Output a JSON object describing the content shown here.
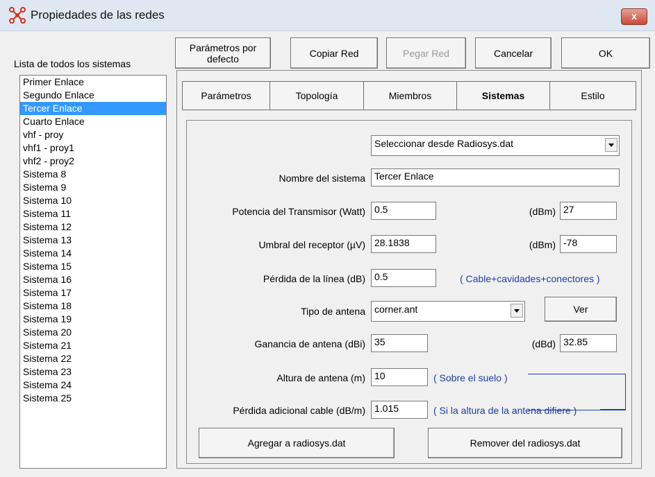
{
  "window": {
    "title": "Propiedades de las redes",
    "close_icon": "close-icon",
    "close_label": "x"
  },
  "toolbar": {
    "defaults_label": "Parámetros por defecto",
    "copy_label": "Copiar Red",
    "paste_label": "Pegar Red",
    "cancel_label": "Cancelar",
    "ok_label": "OK"
  },
  "sidebar": {
    "label": "Lista de todos los sistemas",
    "items": [
      "Primer Enlace",
      "Segundo Enlace",
      "Tercer Enlace",
      "Cuarto Enlace",
      "vhf - proy",
      "vhf1 - proy1",
      "vhf2 - proy2",
      "Sistema  8",
      "Sistema  9",
      "Sistema 10",
      "Sistema 11",
      "Sistema 12",
      "Sistema 13",
      "Sistema 14",
      "Sistema 15",
      "Sistema 16",
      "Sistema 17",
      "Sistema 18",
      "Sistema 19",
      "Sistema 20",
      "Sistema 21",
      "Sistema 22",
      "Sistema 23",
      "Sistema 24",
      "Sistema 25"
    ],
    "selected_index": 2
  },
  "tabs": [
    "Parámetros",
    "Topología",
    "Miembros",
    "Sistemas",
    "Estilo"
  ],
  "active_tab": "Sistemas",
  "form": {
    "source_select": "Seleccionar desde Radiosys.dat",
    "name_label": "Nombre del sistema",
    "name_value": "Tercer Enlace",
    "tx_power_label": "Potencia del Transmisor (Watt)",
    "tx_power_value": "0.5",
    "tx_dbm_label": "(dBm)",
    "tx_dbm_value": "27",
    "rx_threshold_label": "Umbral del receptor (µV)",
    "rx_threshold_value": "28.1838",
    "rx_dbm_label": "(dBm)",
    "rx_dbm_value": "-78",
    "line_loss_label": "Pérdida de la línea (dB)",
    "line_loss_value": "0.5",
    "line_loss_note": "( Cable+cavidades+conectores )",
    "antenna_type_label": "Tipo de antena",
    "antenna_type_value": "corner.ant",
    "view_label": "Ver",
    "gain_label": "Ganancia de antena (dBi)",
    "gain_value": "35",
    "gain_dbd_label": "(dBd)",
    "gain_dbd_value": "32.85",
    "height_label": "Altura de antena (m)",
    "height_value": "10",
    "height_note": "( Sobre el suelo )",
    "extra_loss_label": "Pérdida adicional cable (dB/m)",
    "extra_loss_value": "1.015",
    "extra_loss_note": "( Si la altura de la antena difiere )",
    "add_label": "Agregar a radiosys.dat",
    "remove_label": "Remover del radiosys.dat"
  }
}
